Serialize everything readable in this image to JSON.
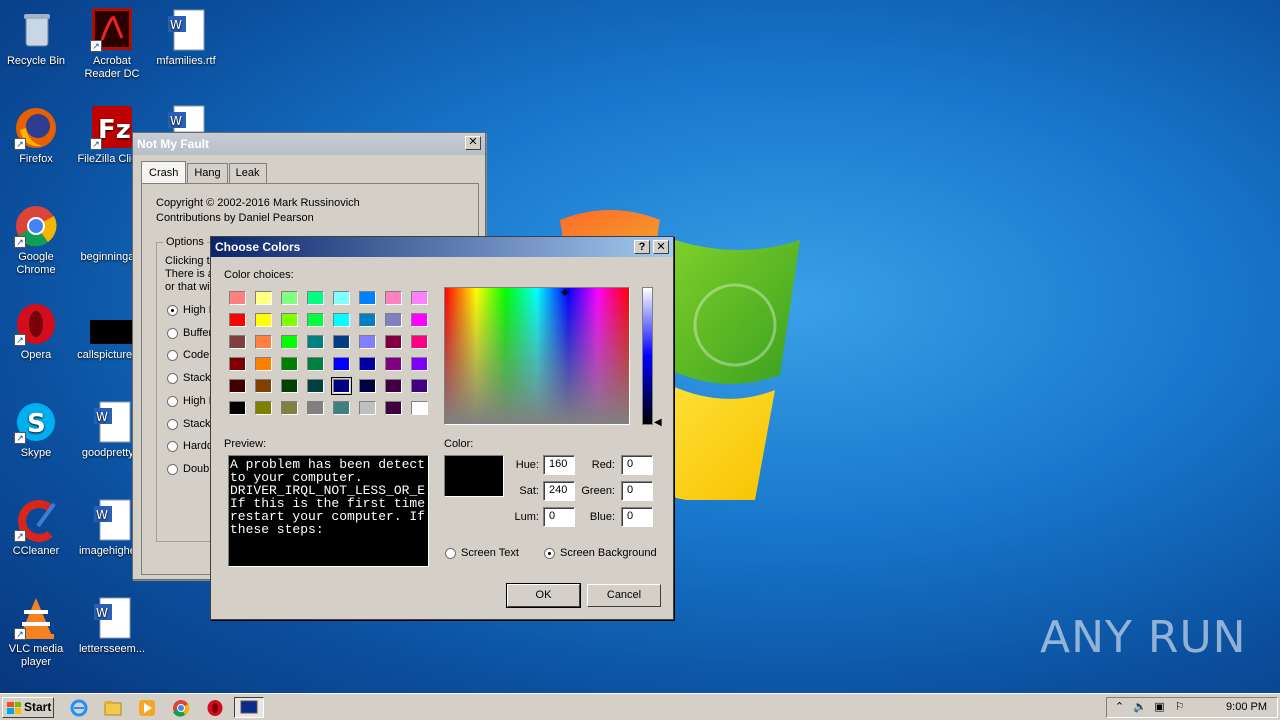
{
  "desktop": {
    "icons": [
      {
        "label": "Recycle Bin",
        "icon": "recycle-bin-icon"
      },
      {
        "label": "Acrobat Reader DC",
        "icon": "acrobat-icon"
      },
      {
        "label": "mfamilies.rtf",
        "icon": "word-doc-icon"
      },
      {
        "label": "Firefox",
        "icon": "firefox-icon"
      },
      {
        "label": "FileZilla Clie...",
        "icon": "filezilla-icon"
      },
      {
        "label": "Google Chrome",
        "icon": "chrome-icon"
      },
      {
        "label": "beginninga...",
        "icon": "blank-icon"
      },
      {
        "label": "Opera",
        "icon": "opera-icon"
      },
      {
        "label": "callspictures...",
        "icon": "black-thumbnail-icon"
      },
      {
        "label": "Skype",
        "icon": "skype-icon"
      },
      {
        "label": "goodpretty...",
        "icon": "word-doc-icon"
      },
      {
        "label": "CCleaner",
        "icon": "ccleaner-icon"
      },
      {
        "label": "imagehighe...",
        "icon": "word-doc-icon"
      },
      {
        "label": "VLC media player",
        "icon": "vlc-icon"
      },
      {
        "label": "lettersseem...",
        "icon": "word-doc-icon"
      }
    ],
    "watermark": "ANY RUN"
  },
  "nmf_window": {
    "title": "Not My Fault",
    "close": "✕",
    "tabs": [
      "Crash",
      "Hang",
      "Leak"
    ],
    "copyright": "Copyright © 2002-2016 Mark Russinovich",
    "contrib": "Contributions by Daniel Pearson",
    "options_label": "Options",
    "desc_lines": [
      "Clicking th",
      "There is a",
      "or that wi"
    ],
    "options": [
      "High I",
      "Buffer",
      "Code",
      "Stack",
      "High I",
      "Stack",
      "Hardc",
      "Doubl"
    ]
  },
  "choose_colors": {
    "title": "Choose Colors",
    "help": "?",
    "close": "✕",
    "color_choices_label": "Color choices:",
    "preview_label": "Preview:",
    "color_label": "Color:",
    "swatches": [
      [
        "#ff8080",
        "#ffff80",
        "#80ff80",
        "#00ff80",
        "#80ffff",
        "#0080ff",
        "#ff80c0",
        "#ff80ff"
      ],
      [
        "#ff0000",
        "#ffff00",
        "#80ff00",
        "#00ff40",
        "#00ffff",
        "#0080c0",
        "#8080c0",
        "#ff00ff"
      ],
      [
        "#804040",
        "#ff8040",
        "#00ff00",
        "#008080",
        "#004080",
        "#8080ff",
        "#800040",
        "#ff0080"
      ],
      [
        "#800000",
        "#ff8000",
        "#008000",
        "#008040",
        "#0000ff",
        "#0000a0",
        "#800080",
        "#8000ff"
      ],
      [
        "#400000",
        "#804000",
        "#004000",
        "#004040",
        "#000080",
        "#000040",
        "#400040",
        "#400080"
      ],
      [
        "#000000",
        "#808000",
        "#808040",
        "#808080",
        "#408080",
        "#c0c0c0",
        "#400040",
        "#ffffff"
      ]
    ],
    "selected_swatch": [
      4,
      4
    ],
    "preview_lines": [
      "A problem has been detect",
      "to your computer.",
      "",
      "DRIVER_IRQL_NOT_LESS_OR_E",
      "",
      "If this is the first time",
      "restart your computer. If",
      "these steps:"
    ],
    "hue_label": "Hue:",
    "hue": "160",
    "sat_label": "Sat:",
    "sat": "240",
    "lum_label": "Lum:",
    "lum": "0",
    "red_label": "Red:",
    "red": "0",
    "green_label": "Green:",
    "green": "0",
    "blue_label": "Blue:",
    "blue": "0",
    "radio_text": "Screen Text",
    "radio_background": "Screen Background",
    "selected_target": "Screen Background",
    "ok": "OK",
    "cancel": "Cancel"
  },
  "taskbar": {
    "start": "Start",
    "quick_launch": [
      "ie-icon",
      "explorer-icon",
      "media-player-icon",
      "chrome-icon",
      "opera-icon"
    ],
    "clock": "9:00 PM",
    "tray_icons": [
      "chevron-up-icon",
      "volume-icon",
      "network-icon",
      "flag-icon"
    ]
  }
}
